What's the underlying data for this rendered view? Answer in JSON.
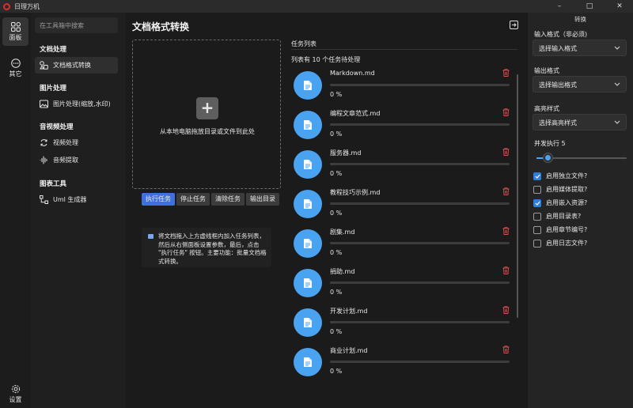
{
  "window": {
    "title": "日理万机",
    "minimize": "–",
    "maximize": "□",
    "close": "✕"
  },
  "rail": {
    "panel": "面板",
    "other": "其它",
    "settings": "设置"
  },
  "toolbox": {
    "search_placeholder": "在工具箱中搜索",
    "groups": [
      {
        "title": "文档处理",
        "items": [
          "文档格式转换"
        ]
      },
      {
        "title": "图片处理",
        "items": [
          "图片处理(缩放,水印)"
        ]
      },
      {
        "title": "音视频处理",
        "items": [
          "视频处理",
          "音频提取"
        ]
      },
      {
        "title": "图表工具",
        "items": [
          "Uml 生成器"
        ]
      }
    ]
  },
  "main": {
    "title": "文档格式转换",
    "dropzone_text": "从本地电脑拖放目录或文件到此处",
    "buttons": {
      "run": "执行任务",
      "stop": "停止任务",
      "clear": "清除任务",
      "output": "输出目录"
    },
    "hint": "将文档拖入上方虚线框内加入任务列表，然后从右侧面板设置参数，最后，点击 \"执行任务\" 按钮。主要功能：批量文档格式转换。",
    "task_header": "任务列表",
    "task_count": "列表有 10 个任务待处理",
    "tasks": [
      {
        "name": "Markdown.md",
        "progress": "0 %"
      },
      {
        "name": "编程文章范式.md",
        "progress": "0 %"
      },
      {
        "name": "服务器.md",
        "progress": "0 %"
      },
      {
        "name": "教程技巧示例.md",
        "progress": "0 %"
      },
      {
        "name": "剧集.md",
        "progress": "0 %"
      },
      {
        "name": "捐助.md",
        "progress": "0 %"
      },
      {
        "name": "开发计划.md",
        "progress": "0 %"
      },
      {
        "name": "商业计划.md",
        "progress": "0 %"
      }
    ]
  },
  "panel": {
    "title": "转换",
    "input_format_label": "输入格式（非必须)",
    "input_format_value": "选择输入格式",
    "output_format_label": "输出格式",
    "output_format_value": "选择输出格式",
    "highlight_label": "高亮样式",
    "highlight_value": "选择高亮样式",
    "concurrency_label": "并发执行 5",
    "concurrency_value": 5,
    "options": [
      {
        "label": "启用独立文件?",
        "checked": true
      },
      {
        "label": "启用媒体提取?",
        "checked": false
      },
      {
        "label": "启用嵌入资源?",
        "checked": true
      },
      {
        "label": "启用目录表?",
        "checked": false
      },
      {
        "label": "启用章节编号?",
        "checked": false
      },
      {
        "label": "启用日志文件?",
        "checked": false
      }
    ]
  },
  "colors": {
    "accent": "#3f6fe0",
    "file_icon": "#4aa3f0",
    "trash": "#e05050"
  }
}
